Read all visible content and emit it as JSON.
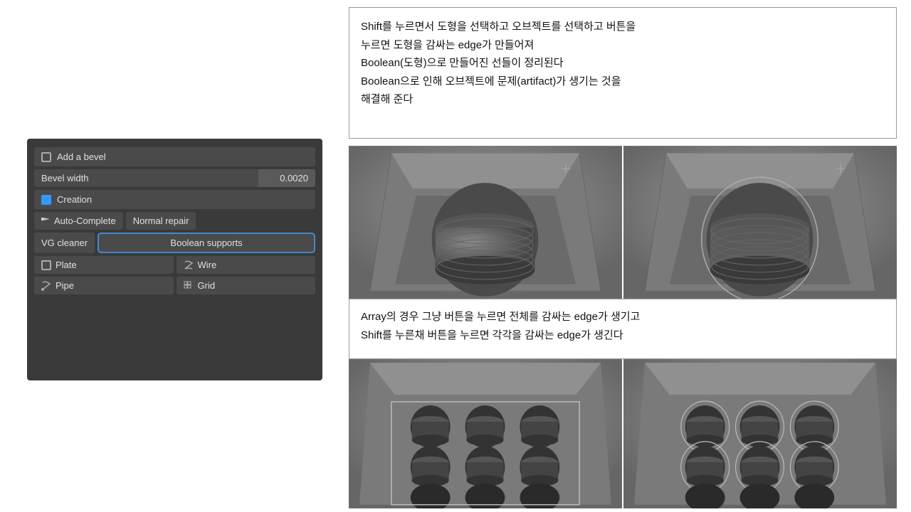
{
  "leftPanel": {
    "addBevelLabel": "Add a bevel",
    "bevelWidthLabel": "Bevel width",
    "bevelWidthValue": "0.0020",
    "creationLabel": "Creation",
    "autoCompleteLabel": "Auto-Complete",
    "normalRepairLabel": "Normal repair",
    "vgCleanerLabel": "VG cleaner",
    "booleanSupportsLabel": "Boolean supports",
    "plateLabel": "Plate",
    "wireLabel": "Wire",
    "pipeLabel": "Pipe",
    "gridLabel": "Grid"
  },
  "textBoxTop": {
    "line1": "Shift를 누르면서 도형을 선택하고 오브젝트를 선택하고 버튼을",
    "line2": "누르면 도형을 감싸는 edge가 만들어져",
    "line3": "Boolean(도형)으로 만들어진 선들이 정리된다",
    "line4": "Boolean으로 인해 오브젝트에 문제(artifact)가 생기는 것을",
    "line5": "해결해 준다"
  },
  "textBoxMiddle": {
    "line1": "Array의 경우 그냥 버튼을 누르면 전체를 감싸는 edge가 생기고",
    "line2": "Shift를 누른채 버튼을 누르면 각각을 감싸는 edge가 생긴다"
  },
  "colors": {
    "panelBg": "#3a3a3a",
    "buttonBg": "#4a4a4a",
    "booleanBorder": "#4488cc",
    "renderBg": "#808080"
  }
}
